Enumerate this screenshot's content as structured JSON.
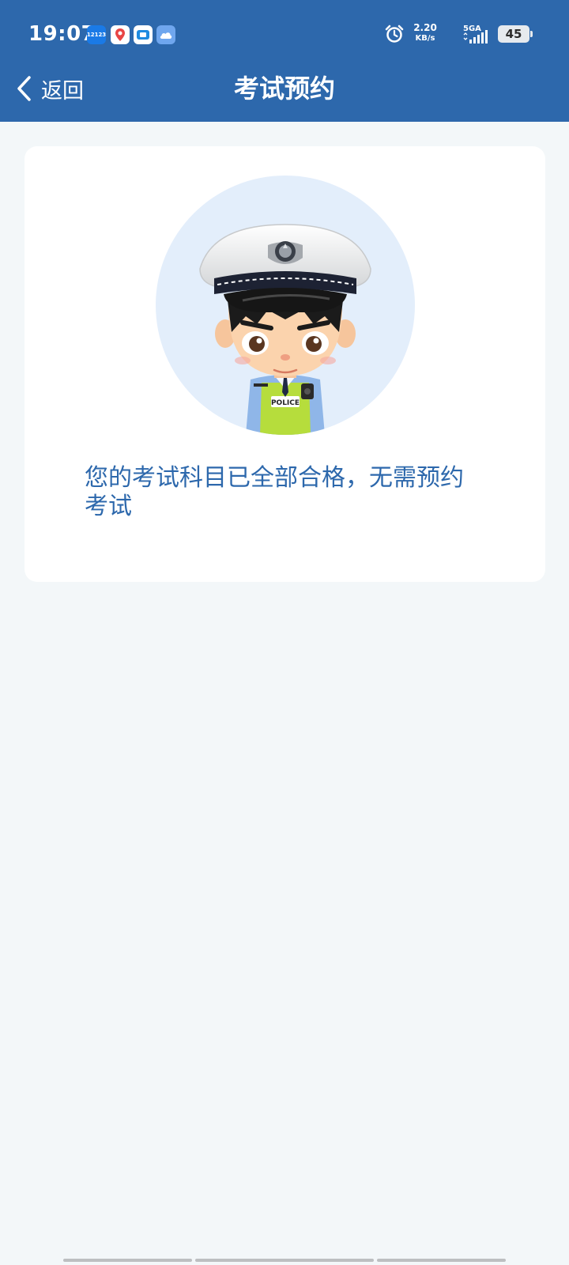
{
  "status_bar": {
    "time": "19:07",
    "notification_icons": [
      "12123-app-icon",
      "maps-icon",
      "messaging-icon",
      "cloud-icon"
    ],
    "net_speed_value": "2.20",
    "net_speed_unit": "KB/s",
    "network_type": "5GA",
    "battery": "45"
  },
  "header": {
    "back_label": "返回",
    "title": "考试预约"
  },
  "main": {
    "avatar_icon": "police-officer-avatar",
    "message": "您的考试科目已全部合格，无需预约考试"
  },
  "colors": {
    "header_bg": "#2d68ac",
    "page_bg": "#f3f7f9",
    "card_bg": "#ffffff",
    "text_accent": "#2d68ac",
    "avatar_circle": "#e3eefb"
  }
}
